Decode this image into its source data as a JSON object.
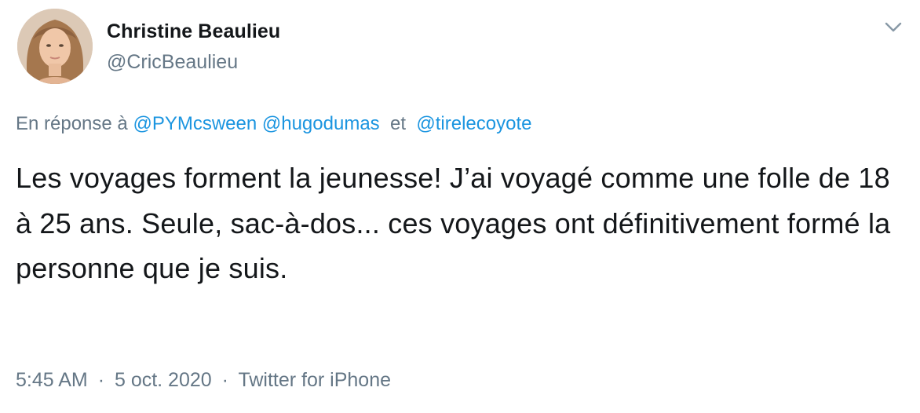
{
  "author": {
    "display_name": "Christine Beaulieu",
    "handle": "@CricBeaulieu"
  },
  "reply": {
    "prefix": "En réponse à",
    "mentions": [
      "@PYMcsween",
      "@hugodumas",
      "@tirelecoyote"
    ],
    "conjunction": "et"
  },
  "tweet": {
    "text": "Les voyages forment la jeunesse! J’ai voyagé comme une folle de 18 à 25 ans. Seule, sac-à-dos... ces voyages ont définitivement formé la personne que je suis."
  },
  "meta": {
    "time": "5:45 AM",
    "separator": "·",
    "date": "5 oct. 2020",
    "source": "Twitter for iPhone"
  },
  "icons": {
    "menu": "chevron-down-icon"
  },
  "colors": {
    "text": "#14171a",
    "secondary": "#657786",
    "link": "#1b95e0"
  }
}
